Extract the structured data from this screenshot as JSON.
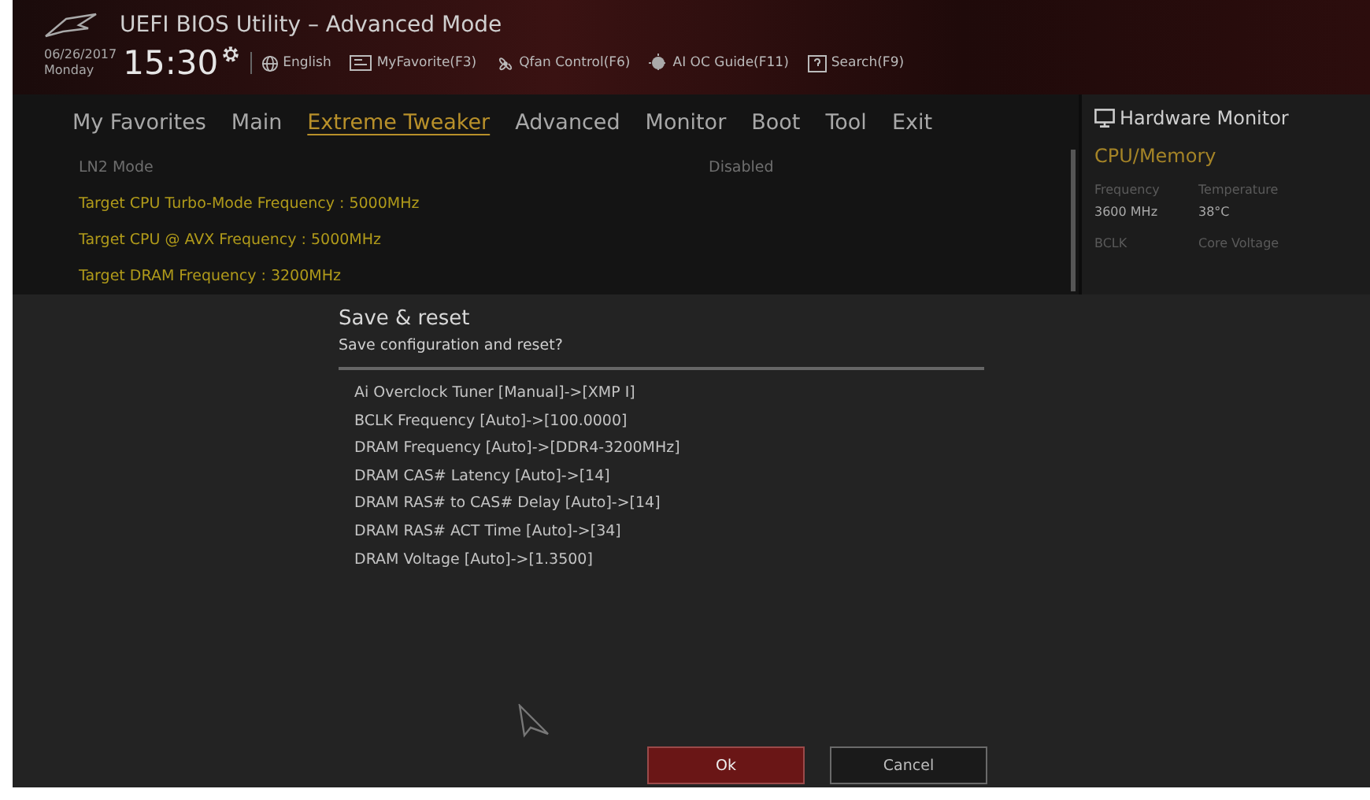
{
  "header": {
    "title": "UEFI BIOS Utility – Advanced Mode",
    "date": "06/26/2017",
    "day": "Monday",
    "time": "15:30",
    "toolbar": [
      {
        "label": "English"
      },
      {
        "label": "MyFavorite(F3)"
      },
      {
        "label": "Qfan Control(F6)"
      },
      {
        "label": "AI OC Guide(F11)"
      },
      {
        "label": "Search(F9)"
      }
    ]
  },
  "tabs": [
    {
      "label": "My Favorites",
      "selected": false
    },
    {
      "label": "Main",
      "selected": false
    },
    {
      "label": "Extreme Tweaker",
      "selected": true
    },
    {
      "label": "Advanced",
      "selected": false
    },
    {
      "label": "Monitor",
      "selected": false
    },
    {
      "label": "Boot",
      "selected": false
    },
    {
      "label": "Tool",
      "selected": false
    },
    {
      "label": "Exit",
      "selected": false
    }
  ],
  "settings": [
    {
      "label": "LN2 Mode",
      "value": "Disabled",
      "disabled": true
    },
    {
      "label": "Target CPU Turbo-Mode Frequency : 5000MHz",
      "disabled": false
    },
    {
      "label": "Target CPU @ AVX Frequency : 5000MHz",
      "disabled": false
    },
    {
      "label": "Target DRAM Frequency : 3200MHz",
      "disabled": false
    }
  ],
  "hardware_monitor": {
    "title": "Hardware Monitor",
    "section": "CPU/Memory",
    "readings": [
      {
        "label": "Frequency",
        "value": "3600 MHz"
      },
      {
        "label": "Temperature",
        "value": "38°C"
      },
      {
        "label": "BCLK"
      },
      {
        "label": "Core Voltage"
      }
    ]
  },
  "dialog": {
    "title": "Save & reset",
    "question": "Save configuration and reset?",
    "changes": [
      "Ai Overclock Tuner [Manual]->[XMP I]",
      "BCLK Frequency [Auto]->[100.0000]",
      "DRAM Frequency [Auto]->[DDR4-3200MHz]",
      "DRAM CAS# Latency [Auto]->[14]",
      "DRAM RAS# to CAS# Delay [Auto]->[14]",
      "DRAM RAS# ACT Time [Auto]->[34]",
      "DRAM Voltage [Auto]->[1.3500]"
    ],
    "buttons": [
      {
        "label": "Ok",
        "selected": true
      },
      {
        "label": "Cancel",
        "selected": false
      }
    ]
  }
}
